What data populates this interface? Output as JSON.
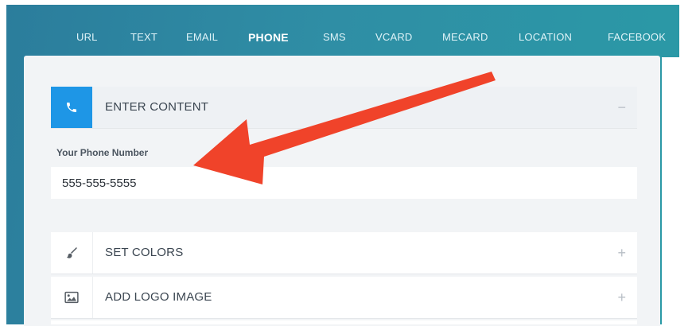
{
  "tabs": [
    {
      "label": "URL",
      "active": false
    },
    {
      "label": "TEXT",
      "active": false
    },
    {
      "label": "EMAIL",
      "active": false
    },
    {
      "label": "PHONE",
      "active": true
    },
    {
      "label": "SMS",
      "active": false
    },
    {
      "label": "VCARD",
      "active": false
    },
    {
      "label": "MECARD",
      "active": false
    },
    {
      "label": "LOCATION",
      "active": false
    },
    {
      "label": "FACEBOOK",
      "active": false
    }
  ],
  "content": {
    "header_label": "ENTER CONTENT",
    "toggle": "−",
    "icon": "phone-icon",
    "field_label": "Your Phone Number",
    "phone_value": "555-555-5555"
  },
  "sections": [
    {
      "label": "SET COLORS",
      "toggle": "+",
      "icon": "brush-icon"
    },
    {
      "label": "ADD LOGO IMAGE",
      "toggle": "+",
      "icon": "image-icon"
    }
  ],
  "colors": {
    "header_bg": "#2b8aa1",
    "accent": "#1e96e6",
    "annotation_arrow": "#f0432a"
  }
}
